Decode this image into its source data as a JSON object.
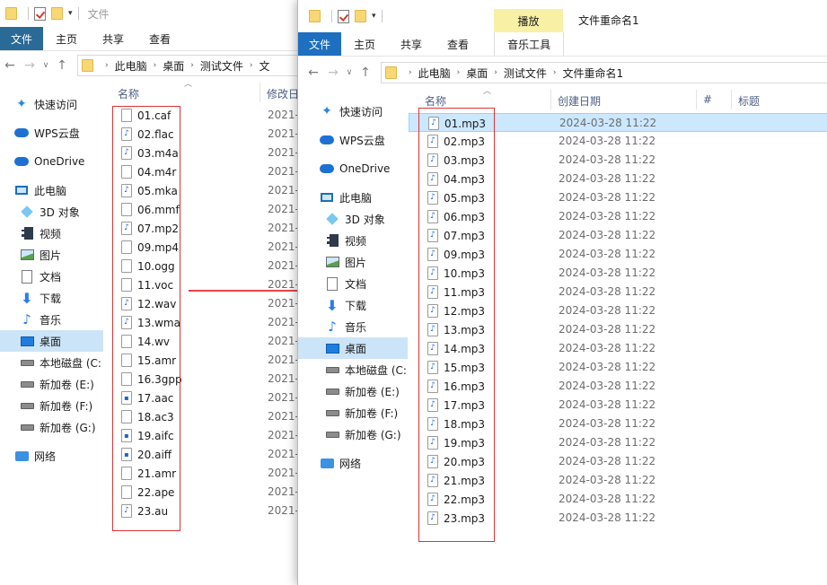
{
  "window1": {
    "title": "文件",
    "ribbon_tabs": [
      "文件",
      "主页",
      "共享",
      "查看"
    ],
    "breadcrumb": [
      "此电脑",
      "桌面",
      "测试文件",
      "文"
    ],
    "columns": {
      "name": "名称",
      "modified": "修改日"
    },
    "sidebar": [
      {
        "label": "快速访问",
        "icon": "star-icon"
      },
      {
        "label": "WPS云盘",
        "icon": "cloud-icon"
      },
      {
        "label": "OneDrive",
        "icon": "cloud-icon"
      },
      {
        "label": "此电脑",
        "icon": "computer-icon"
      },
      {
        "label": "3D 对象",
        "icon": "cube-icon"
      },
      {
        "label": "视频",
        "icon": "video-icon"
      },
      {
        "label": "图片",
        "icon": "picture-icon"
      },
      {
        "label": "文档",
        "icon": "document-icon"
      },
      {
        "label": "下载",
        "icon": "download-icon"
      },
      {
        "label": "音乐",
        "icon": "music-icon"
      },
      {
        "label": "桌面",
        "icon": "desktop-icon"
      },
      {
        "label": "本地磁盘 (C:",
        "icon": "drive-icon"
      },
      {
        "label": "新加卷 (E:)",
        "icon": "drive-icon"
      },
      {
        "label": "新加卷 (F:)",
        "icon": "drive-icon"
      },
      {
        "label": "新加卷 (G:)",
        "icon": "drive-icon"
      },
      {
        "label": "网络",
        "icon": "network-icon"
      }
    ],
    "files": [
      {
        "name": "01.caf",
        "icon": "plain",
        "date": "2021-"
      },
      {
        "name": "02.flac",
        "icon": "wav",
        "date": "2021-"
      },
      {
        "name": "03.m4a",
        "icon": "wav",
        "date": "2021-"
      },
      {
        "name": "04.m4r",
        "icon": "plain",
        "date": "2021-"
      },
      {
        "name": "05.mka",
        "icon": "wav",
        "date": "2021-"
      },
      {
        "name": "06.mmf",
        "icon": "plain",
        "date": "2021-"
      },
      {
        "name": "07.mp2",
        "icon": "wav",
        "date": "2021-"
      },
      {
        "name": "09.mp4",
        "icon": "plain",
        "date": "2021-"
      },
      {
        "name": "10.ogg",
        "icon": "plain",
        "date": "2021-"
      },
      {
        "name": "11.voc",
        "icon": "plain",
        "date": "2021-"
      },
      {
        "name": "12.wav",
        "icon": "wav",
        "date": "2021-"
      },
      {
        "name": "13.wma",
        "icon": "wav",
        "date": "2021-"
      },
      {
        "name": "14.wv",
        "icon": "plain",
        "date": "2021-"
      },
      {
        "name": "15.amr",
        "icon": "plain",
        "date": "2021-"
      },
      {
        "name": "16.3gpp",
        "icon": "plain",
        "date": "2021-"
      },
      {
        "name": "17.aac",
        "icon": "aac",
        "date": "2021-"
      },
      {
        "name": "18.ac3",
        "icon": "plain",
        "date": "2021-"
      },
      {
        "name": "19.aifc",
        "icon": "aac",
        "date": "2021-"
      },
      {
        "name": "20.aiff",
        "icon": "aac",
        "date": "2021-"
      },
      {
        "name": "21.amr",
        "icon": "plain",
        "date": "2021-"
      },
      {
        "name": "22.ape",
        "icon": "plain",
        "date": "2021-"
      },
      {
        "name": "23.au",
        "icon": "wav",
        "date": "2021-"
      }
    ]
  },
  "window2": {
    "title": "文件重命名1",
    "context_tab": "播放",
    "ribbon_tabs": [
      "文件",
      "主页",
      "共享",
      "查看",
      "音乐工具"
    ],
    "breadcrumb": [
      "此电脑",
      "桌面",
      "测试文件",
      "文件重命名1"
    ],
    "columns": {
      "name": "名称",
      "created": "创建日期",
      "number": "#",
      "title": "标题"
    },
    "sidebar": [
      {
        "label": "快速访问",
        "icon": "star-icon"
      },
      {
        "label": "WPS云盘",
        "icon": "cloud-icon"
      },
      {
        "label": "OneDrive",
        "icon": "cloud-icon"
      },
      {
        "label": "此电脑",
        "icon": "computer-icon"
      },
      {
        "label": "3D 对象",
        "icon": "cube-icon"
      },
      {
        "label": "视频",
        "icon": "video-icon"
      },
      {
        "label": "图片",
        "icon": "picture-icon"
      },
      {
        "label": "文档",
        "icon": "document-icon"
      },
      {
        "label": "下载",
        "icon": "download-icon"
      },
      {
        "label": "音乐",
        "icon": "music-icon"
      },
      {
        "label": "桌面",
        "icon": "desktop-icon"
      },
      {
        "label": "本地磁盘 (C:",
        "icon": "drive-icon"
      },
      {
        "label": "新加卷 (E:)",
        "icon": "drive-icon"
      },
      {
        "label": "新加卷 (F:)",
        "icon": "drive-icon"
      },
      {
        "label": "新加卷 (G:)",
        "icon": "drive-icon"
      },
      {
        "label": "网络",
        "icon": "network-icon"
      }
    ],
    "files": [
      {
        "name": "01.mp3",
        "date": "2024-03-28 11:22"
      },
      {
        "name": "02.mp3",
        "date": "2024-03-28 11:22"
      },
      {
        "name": "03.mp3",
        "date": "2024-03-28 11:22"
      },
      {
        "name": "04.mp3",
        "date": "2024-03-28 11:22"
      },
      {
        "name": "05.mp3",
        "date": "2024-03-28 11:22"
      },
      {
        "name": "06.mp3",
        "date": "2024-03-28 11:22"
      },
      {
        "name": "07.mp3",
        "date": "2024-03-28 11:22"
      },
      {
        "name": "09.mp3",
        "date": "2024-03-28 11:22"
      },
      {
        "name": "10.mp3",
        "date": "2024-03-28 11:22"
      },
      {
        "name": "11.mp3",
        "date": "2024-03-28 11:22"
      },
      {
        "name": "12.mp3",
        "date": "2024-03-28 11:22"
      },
      {
        "name": "13.mp3",
        "date": "2024-03-28 11:22"
      },
      {
        "name": "14.mp3",
        "date": "2024-03-28 11:22"
      },
      {
        "name": "15.mp3",
        "date": "2024-03-28 11:22"
      },
      {
        "name": "16.mp3",
        "date": "2024-03-28 11:22"
      },
      {
        "name": "17.mp3",
        "date": "2024-03-28 11:22"
      },
      {
        "name": "18.mp3",
        "date": "2024-03-28 11:22"
      },
      {
        "name": "19.mp3",
        "date": "2024-03-28 11:22"
      },
      {
        "name": "20.mp3",
        "date": "2024-03-28 11:22"
      },
      {
        "name": "21.mp3",
        "date": "2024-03-28 11:22"
      },
      {
        "name": "22.mp3",
        "date": "2024-03-28 11:22"
      },
      {
        "name": "23.mp3",
        "date": "2024-03-28 11:22"
      }
    ]
  },
  "colors": {
    "annotation_red": "#e03232",
    "file_tab_blue": "#1e6fbf",
    "selection": "#cce8ff"
  }
}
